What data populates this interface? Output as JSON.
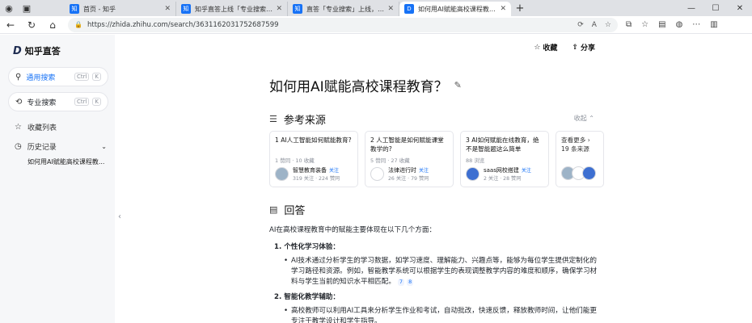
{
  "browser": {
    "tabs": [
      {
        "favicon": "知",
        "title": "首页 - 知乎"
      },
      {
        "favicon": "知",
        "title": "知乎直答上线「专业搜索」功能"
      },
      {
        "favicon": "知",
        "title": "直答「专业搜索」上线，遍你的AI"
      },
      {
        "favicon": "D",
        "title": "如何用AI赋能高校课程教育？ - 知"
      }
    ],
    "url": "https://zhida.zhihu.com/search/3631162031752687599"
  },
  "sidebar": {
    "logo": "知乎直答",
    "general_search": {
      "label": "通用搜索",
      "key1": "Ctrl",
      "key2": "K"
    },
    "pro_search": {
      "label": "专业搜索",
      "key1": "Ctrl",
      "key2": "K"
    },
    "favorites": "收藏列表",
    "history": "历史记录",
    "history_items": [
      "如何用AI赋能高校课程教..."
    ]
  },
  "header": {
    "collect": "收藏",
    "share": "分享"
  },
  "question": {
    "title": "如何用AI赋能高校课程教育？"
  },
  "references": {
    "heading": "参考来源",
    "collapse": "收起",
    "cards": [
      {
        "title": "1 AI人工智能如何赋能教育?",
        "meta": "1 赞同 · 10 收藏",
        "author": "智慧教育装备",
        "badge": "关注",
        "stats": "319 关注 · 224 赞同"
      },
      {
        "title": "2 人工智能是如何赋能课堂教学的?",
        "meta": "5 赞同 · 27 收藏",
        "author": "法律进行时",
        "badge": "关注",
        "stats": "26 关注 · 79 赞同"
      },
      {
        "title": "3 AI如何赋能在线教育，绝不是智能题这么简单",
        "meta": "88 浏览",
        "author": "saas网校搭建",
        "badge": "关注",
        "stats": "2 关注 · 28 赞同"
      }
    ],
    "more": {
      "line1": "查看更多",
      "line2": "19 条来源"
    }
  },
  "answer": {
    "heading": "回答",
    "intro": "AI在高校课程教育中的赋能主要体现在以下几个方面：",
    "points": [
      {
        "title": "1. 个性化学习体验：",
        "bullets": [
          {
            "text": "AI技术通过分析学生的学习数据，如学习速度、理解能力、兴趣点等，能够为每位学生提供定制化的学习路径和资源。例如，智能教学系统可以根据学生的表现调整教学内容的难度和顺序，确保学习材料与学生当前的知识水平相匹配。",
            "cites": [
              "7",
              "8"
            ]
          }
        ]
      },
      {
        "title": "2. 智能化教学辅助：",
        "bullets": [
          {
            "text": "高校教师可以利用AI工具来分析学生作业和考试，自动批改，快速反馈，释放教师时间，让他们能更专注于教学设计和学生指导。",
            "cites": []
          }
        ]
      }
    ]
  }
}
